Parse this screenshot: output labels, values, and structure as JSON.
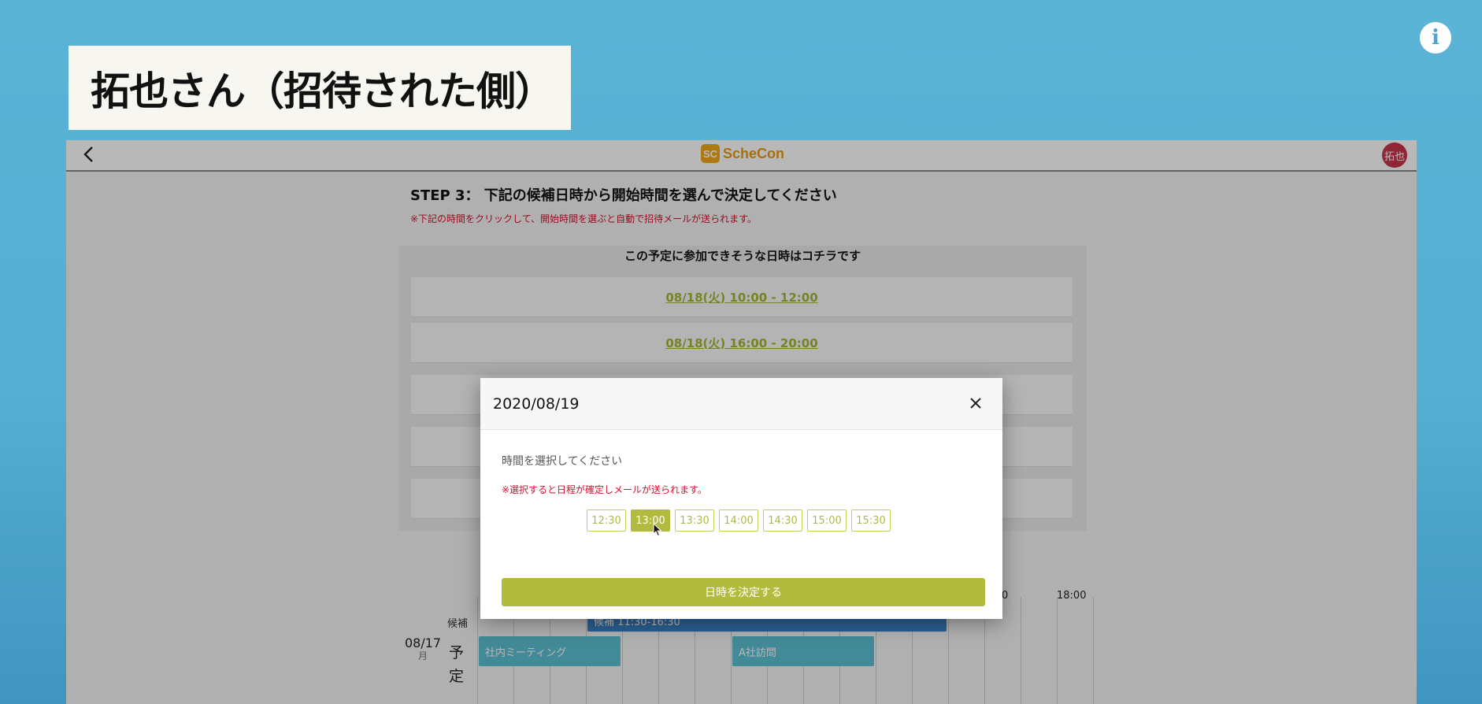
{
  "overlay_title": "拓也さん（招待された側）",
  "info_icon": "i",
  "app": {
    "logo_mark": "SC",
    "logo_text": "ScheCon",
    "avatar_text": "拓也",
    "step_title": "STEP 3：  下記の候補日時から開始時間を選んで決定してください",
    "step_note": "※下記の時間をクリックして、開始時間を選ぶと自動で招待メールが送られます。",
    "candidates_heading": "この予定に参加できそうな日時はコチラです",
    "slots": [
      "08/18(火) 10:00 - 12:00",
      "08/18(火) 16:00 - 20:00"
    ]
  },
  "timeline": {
    "time_labels": [
      "0",
      "18:00"
    ],
    "row_kouho": "候補",
    "kouho_bar": "候補 11:30-16:30",
    "date": "08/17",
    "weekday": "月",
    "yotei": "予定",
    "events": [
      "社内ミーティング",
      "A社訪問"
    ]
  },
  "modal": {
    "title": "2020/08/19",
    "prompt": "時間を選択してください",
    "note": "※選択すると日程が確定しメールが送られます。",
    "times": [
      "12:30",
      "13:00",
      "13:30",
      "14:00",
      "14:30",
      "15:00",
      "15:30"
    ],
    "selected_time": "13:00",
    "confirm_label": "日時を決定する"
  },
  "colors": {
    "background": "#56aed2",
    "accent": "#b3bb3e",
    "alert": "#d2122e",
    "avatar": "#c8344a",
    "logo": "#e89b12"
  }
}
